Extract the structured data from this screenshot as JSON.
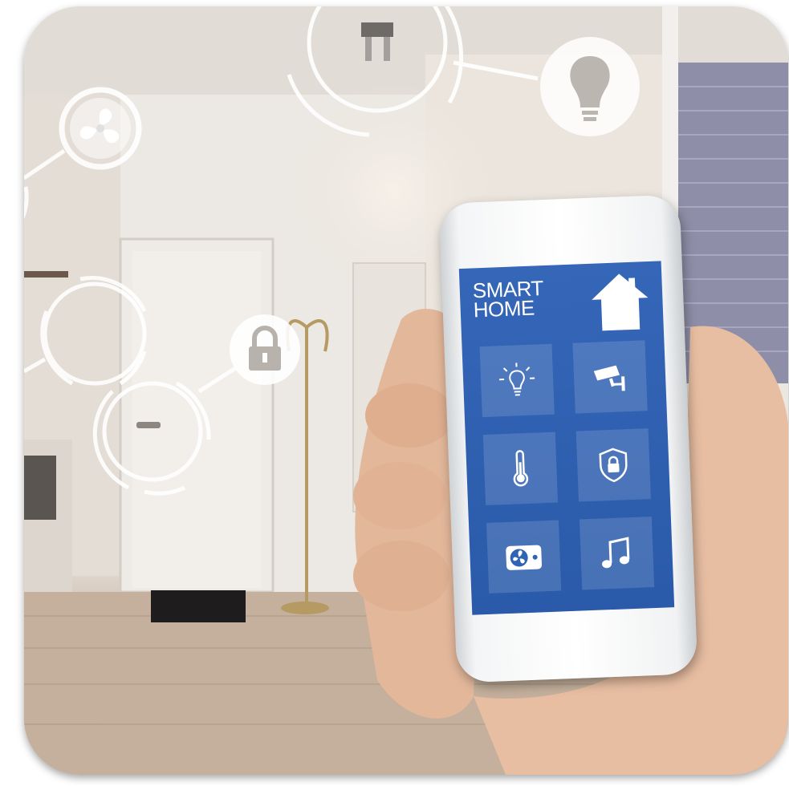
{
  "app": {
    "title_line1": "SMART",
    "title_line2": "HOME"
  },
  "icons": {
    "house": "house-icon",
    "tiles": [
      {
        "name": "light-bulb-icon"
      },
      {
        "name": "security-camera-icon"
      },
      {
        "name": "thermometer-icon"
      },
      {
        "name": "shield-lock-icon"
      },
      {
        "name": "fan-icon"
      },
      {
        "name": "music-note-icon"
      }
    ],
    "overlay": [
      "ceiling-light-icon",
      "light-bulb-icon",
      "fan-icon",
      "padlock-icon"
    ]
  },
  "colors": {
    "screen_blue": "#2f63b4",
    "overlay_white": "#ffffff"
  }
}
